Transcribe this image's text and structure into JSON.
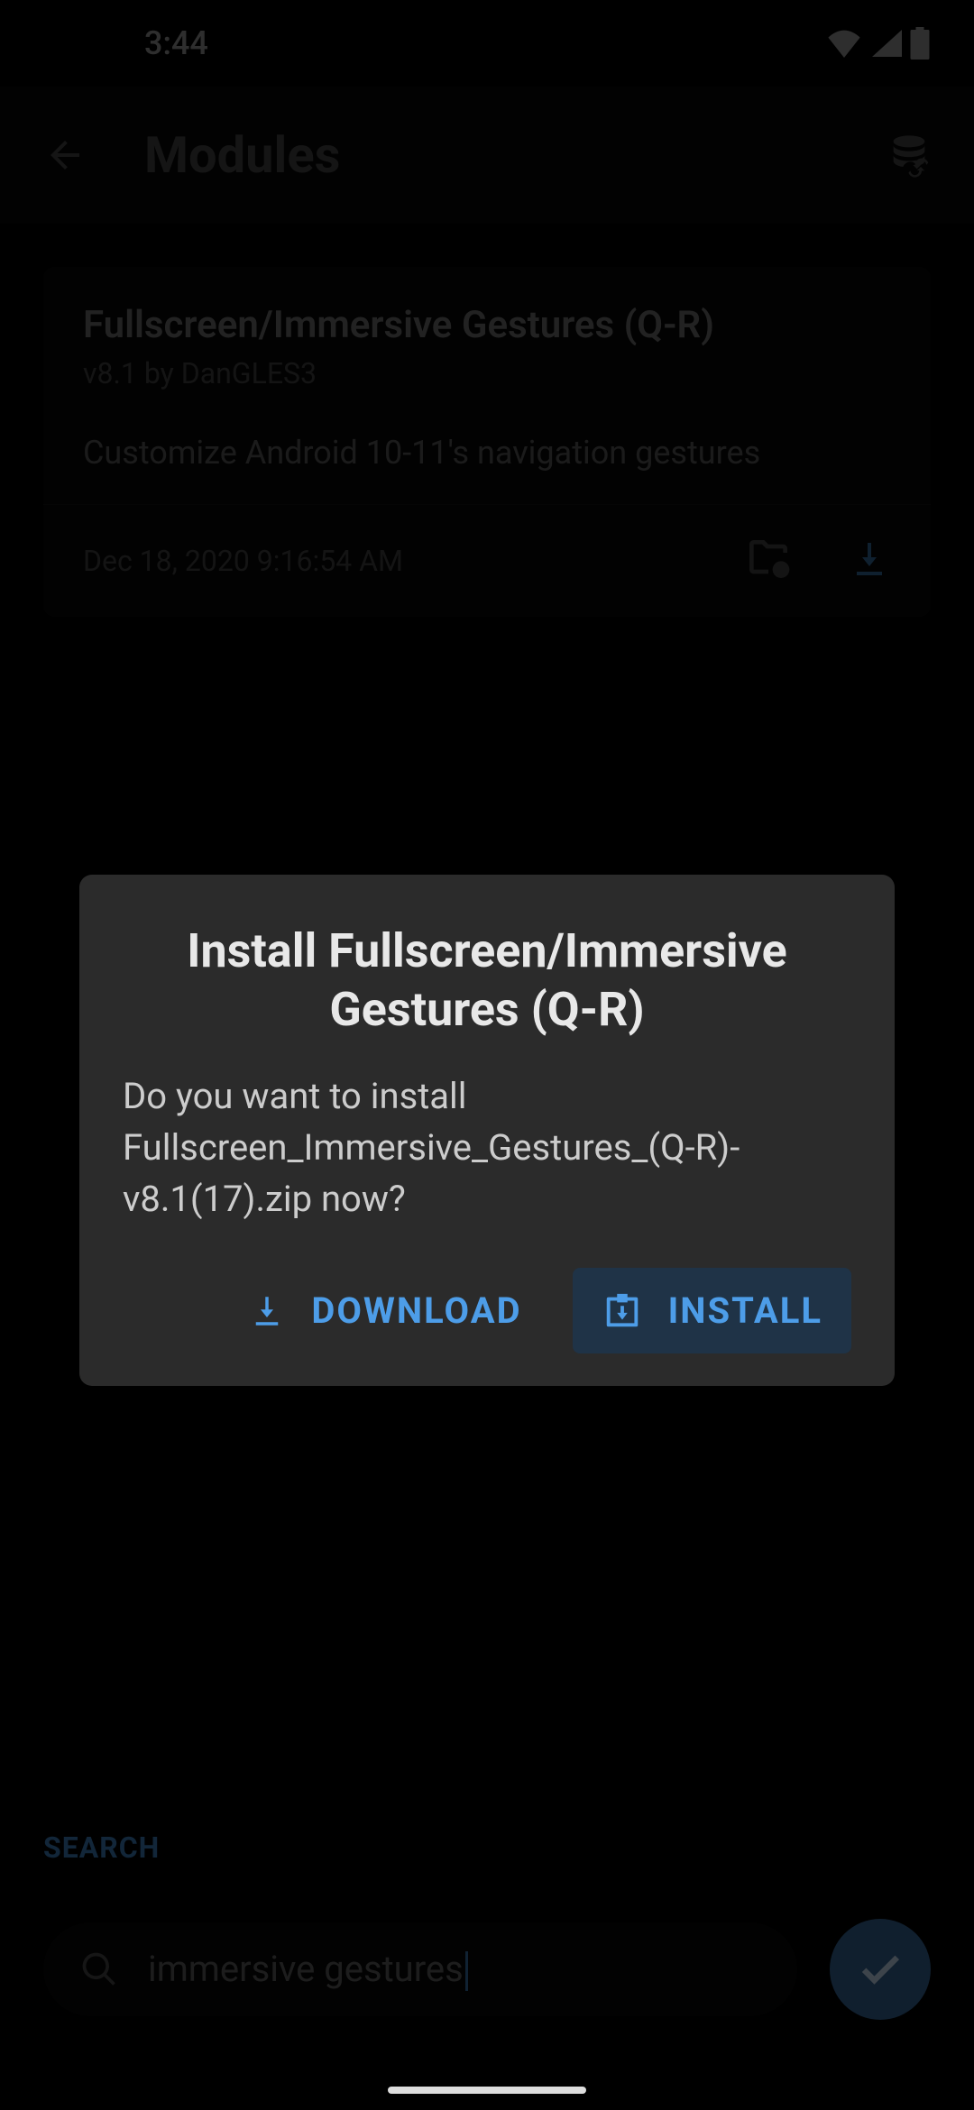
{
  "status": {
    "time": "3:44"
  },
  "appbar": {
    "title": "Modules"
  },
  "module": {
    "title": "Fullscreen/Immersive Gestures (Q-R)",
    "subtitle": "v8.1 by DanGLES3",
    "description": "Customize Android 10-11's navigation gestures",
    "date": "Dec 18, 2020 9:16:54 AM"
  },
  "dialog": {
    "title": "Install Fullscreen/Immersive Gestures (Q-R)",
    "body": "Do you want to install Fullscreen_Immersive_Gestures_(Q-R)-v8.1(17).zip now?",
    "download_label": "DOWNLOAD",
    "install_label": "INSTALL"
  },
  "search": {
    "label": "SEARCH",
    "value": "immersive gestures"
  },
  "colors": {
    "accent": "#4d9de8",
    "dialog_bg": "#2b2b2b",
    "primary_btn_bg": "#1f3347",
    "fab_bg": "#2a4f73"
  }
}
